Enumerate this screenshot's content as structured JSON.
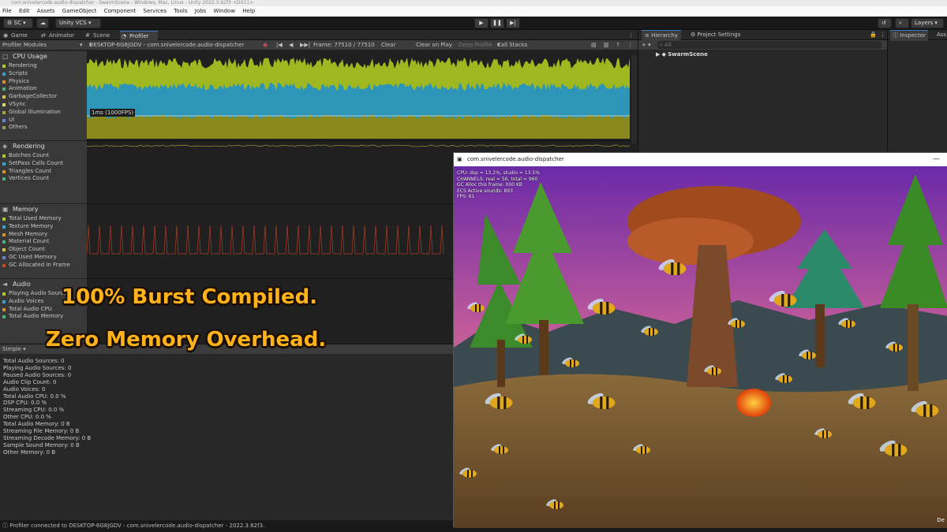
{
  "title": "com.snivelercode.audio-dispatcher - SwarmScene - Windows, Mac, Linux - Unity 2022.3.62f3 <DX11>",
  "menu": [
    "File",
    "Edit",
    "Assets",
    "GameObject",
    "Component",
    "Services",
    "Tools",
    "Jobs",
    "Window",
    "Help"
  ],
  "toolbar": {
    "account": "SC",
    "vcs": "Unity VCS",
    "layers": "Layers"
  },
  "tabs": [
    "Game",
    "Animator",
    "Scene",
    "Profiler"
  ],
  "profiler_toolbar": {
    "modules": "Profiler Modules",
    "target": "DESKTOP-6G8JGDV - com.snivelercode.audio-dispatcher",
    "frame": "Frame: 77510 / 77510",
    "clear": "Clear",
    "clear_on_play": "Clear on Play",
    "deep_profile": "Deep Profile",
    "call_stacks": "Call Stacks"
  },
  "modules": {
    "cpu": {
      "title": "CPU Usage",
      "items": [
        "Rendering",
        "Scripts",
        "Physics",
        "Animation",
        "GarbageCollector",
        "VSync",
        "Global Illumination",
        "UI",
        "Others"
      ],
      "colors": [
        "#b5c72a",
        "#3aa0cf",
        "#d98f2c",
        "#4ab37c",
        "#d2c44e",
        "#ddd96a",
        "#a9a338",
        "#6a86c8",
        "#9a9a58"
      ]
    },
    "rendering": {
      "title": "Rendering",
      "items": [
        "Batches Count",
        "SetPass Calls Count",
        "Triangles Count",
        "Vertices Count"
      ],
      "colors": [
        "#b5c72a",
        "#3aa0cf",
        "#d98f2c",
        "#4ab37c"
      ]
    },
    "memory": {
      "title": "Memory",
      "items": [
        "Total Used Memory",
        "Texture Memory",
        "Mesh Memory",
        "Material Count",
        "Object Count",
        "GC Used Memory",
        "GC Allocated In Frame"
      ],
      "colors": [
        "#b5c72a",
        "#3aa0cf",
        "#d98f2c",
        "#4ab37c",
        "#d2c44e",
        "#6a86c8",
        "#c84a2a"
      ]
    },
    "audio": {
      "title": "Audio",
      "items": [
        "Playing Audio Sources",
        "Audio Voices",
        "Total Audio CPU",
        "Total Audio Memory"
      ],
      "colors": [
        "#b5c72a",
        "#3aa0cf",
        "#d98f2c",
        "#4ab37c"
      ]
    }
  },
  "cpu_label": "1ms (1000FPS)",
  "bottom": {
    "mode": "Simple",
    "stats": [
      "Total Audio Sources: 0",
      "Playing Audio Sources: 0",
      "Paused Audio Sources: 0",
      "Audio Clip Count: 0",
      "Audio Voices: 0",
      "Total Audio CPU: 0.0 %",
      "DSP CPU: 0.0 %",
      "Streaming CPU: 0.0 %",
      "Other CPU: 0.0 %",
      "Total Audio Memory: 0 B",
      "Streaming File Memory: 0 B",
      "Streaming Decode Memory: 0 B",
      "Sample Sound Memory: 0 B",
      "Other Memory: 0 B"
    ]
  },
  "status": "Profiler connected to DESKTOP-6G8JGDV - com.snivelercode.audio-dispatcher - 2022.3.62f3.",
  "hierarchy": {
    "tab": "Hierarchy",
    "tab2": "Project Settings",
    "search_placeholder": "All",
    "root": "SwarmScene"
  },
  "inspector": {
    "tab": "Inspector",
    "tab2": "Ass"
  },
  "game_window": {
    "title": "com.snivelercode.audio-dispatcher",
    "stats": [
      "CPU: dsp = 13.2%, studio = 13.5%",
      "CHANNELS: real = 56, total = 960",
      "GC Alloc this frame: 000 KB",
      "ECS Active sounds: 893",
      "FPS: 61"
    ],
    "corner": "De"
  },
  "overlay": {
    "line1": "100% Burst Compiled.",
    "line2": "Zero Memory Overhead."
  }
}
